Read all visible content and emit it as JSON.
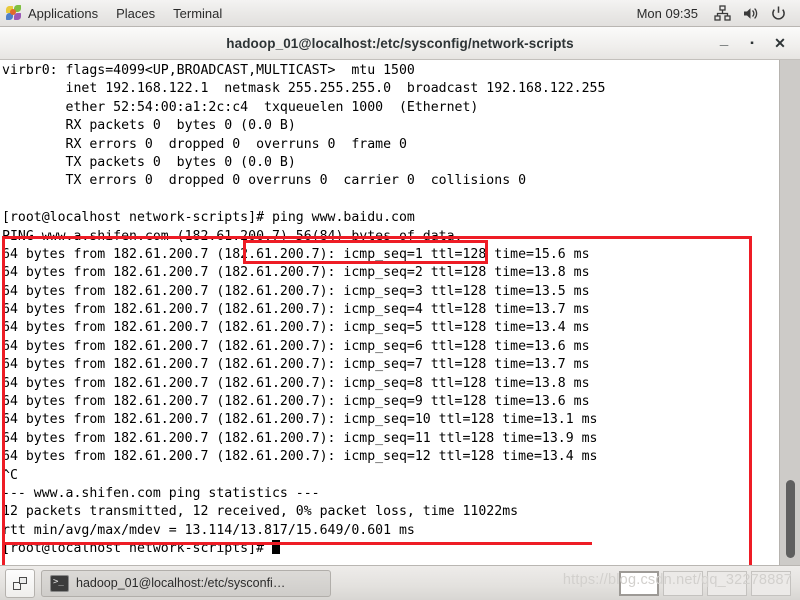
{
  "top_panel": {
    "applications_label": "Applications",
    "places_label": "Places",
    "terminal_label": "Terminal",
    "clock": "Mon 09:35",
    "tray": [
      {
        "name": "network-icon"
      },
      {
        "name": "volume-icon"
      },
      {
        "name": "power-icon"
      }
    ]
  },
  "window": {
    "title": "hadoop_01@localhost:/etc/sysconfig/network-scripts",
    "minimize_label": "_",
    "maximize_label": "▪",
    "close_label": "✕"
  },
  "terminal": {
    "lines": [
      "virbr0: flags=4099<UP,BROADCAST,MULTICAST>  mtu 1500",
      "        inet 192.168.122.1  netmask 255.255.255.0  broadcast 192.168.122.255",
      "        ether 52:54:00:a1:2c:c4  txqueuelen 1000  (Ethernet)",
      "        RX packets 0  bytes 0 (0.0 B)",
      "        RX errors 0  dropped 0  overruns 0  frame 0",
      "        TX packets 0  bytes 0 (0.0 B)",
      "        TX errors 0  dropped 0 overruns 0  carrier 0  collisions 0",
      "",
      "[root@localhost network-scripts]# ping www.baidu.com",
      "PING www.a.shifen.com (182.61.200.7) 56(84) bytes of data.",
      "64 bytes from 182.61.200.7 (182.61.200.7): icmp_seq=1 ttl=128 time=15.6 ms",
      "64 bytes from 182.61.200.7 (182.61.200.7): icmp_seq=2 ttl=128 time=13.8 ms",
      "64 bytes from 182.61.200.7 (182.61.200.7): icmp_seq=3 ttl=128 time=13.5 ms",
      "64 bytes from 182.61.200.7 (182.61.200.7): icmp_seq=4 ttl=128 time=13.7 ms",
      "64 bytes from 182.61.200.7 (182.61.200.7): icmp_seq=5 ttl=128 time=13.4 ms",
      "64 bytes from 182.61.200.7 (182.61.200.7): icmp_seq=6 ttl=128 time=13.6 ms",
      "64 bytes from 182.61.200.7 (182.61.200.7): icmp_seq=7 ttl=128 time=13.7 ms",
      "64 bytes from 182.61.200.7 (182.61.200.7): icmp_seq=8 ttl=128 time=13.8 ms",
      "64 bytes from 182.61.200.7 (182.61.200.7): icmp_seq=9 ttl=128 time=13.6 ms",
      "64 bytes from 182.61.200.7 (182.61.200.7): icmp_seq=10 ttl=128 time=13.1 ms",
      "64 bytes from 182.61.200.7 (182.61.200.7): icmp_seq=11 ttl=128 time=13.9 ms",
      "64 bytes from 182.61.200.7 (182.61.200.7): icmp_seq=12 ttl=128 time=13.4 ms",
      "^C",
      "--- www.a.shifen.com ping statistics ---",
      "12 packets transmitted, 12 received, 0% packet loss, time 11022ms",
      "rtt min/avg/max/mdev = 13.114/13.817/15.649/0.601 ms"
    ],
    "prompt": "[root@localhost network-scripts]# "
  },
  "annotations": {
    "color": "#ee1c25",
    "outer_box_target": "ping output block",
    "command_box_target": "]# ping www.baidu.com",
    "underline_target": "12 packets transmitted, 12 received, 0% packet loss, time 11022ms"
  },
  "taskbar": {
    "show_desktop_name": "show-desktop-icon",
    "task_label": "hadoop_01@localhost:/etc/sysconfi…",
    "workspaces": [
      {
        "active": true
      },
      {
        "active": false
      },
      {
        "active": false
      },
      {
        "active": false
      }
    ]
  },
  "watermark": "https://blog.csdn.net/qq_32278887"
}
